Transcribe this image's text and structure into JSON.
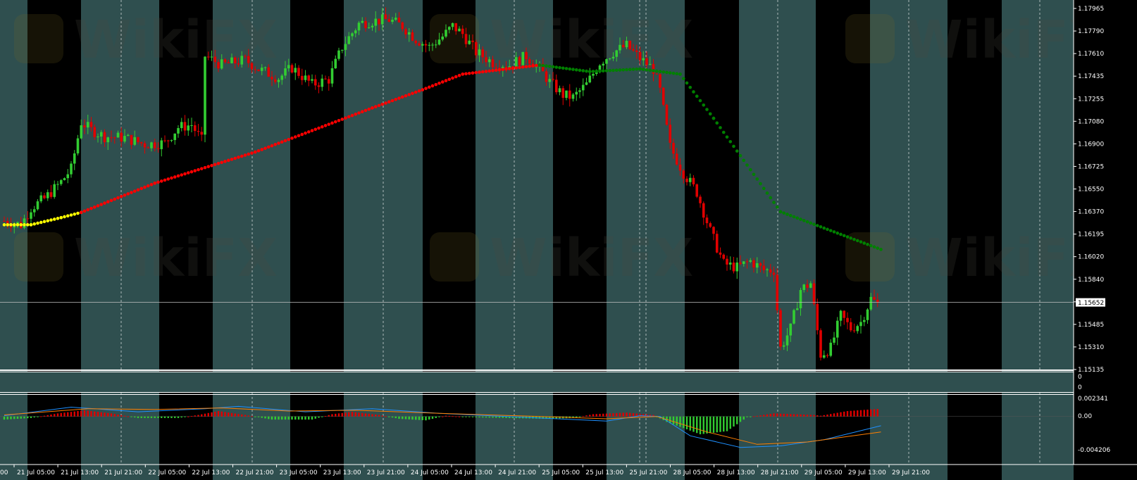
{
  "colors": {
    "bg_dark": "#000000",
    "bg_band": "#2f4f4f",
    "bull_candle": "#32cd32",
    "bear_candle": "#e00000",
    "trail_yellow": "#ffff00",
    "trail_red": "#ff0000",
    "trail_green": "#008000",
    "macd_pos": "#e00000",
    "macd_neg": "#32cd32",
    "macd_line": "#1e90ff",
    "signal_line": "#ff7f00",
    "grid_dash": "#ffffff",
    "text": "#ffffff"
  },
  "watermark": "WikiFX",
  "chart_data": [
    {
      "type": "candlestick",
      "title": "",
      "ylim": [
        1.15135,
        1.17965
      ],
      "yticks": [
        "1.17965",
        "1.17790",
        "1.17610",
        "1.17435",
        "1.17255",
        "1.17080",
        "1.16900",
        "1.16725",
        "1.16550",
        "1.16370",
        "1.16195",
        "1.16020",
        "1.15840",
        "1.15665",
        "1.15485",
        "1.15310",
        "1.15135"
      ],
      "current_price": "1.15652",
      "x_labels": [
        "21 Jul 05:00",
        "21 Jul 13:00",
        "21 Jul 21:00",
        "22 Jul 05:00",
        "22 Jul 13:00",
        "22 Jul 21:00",
        "23 Jul 05:00",
        "23 Jul 13:00",
        "23 Jul 21:00",
        "24 Jul 05:00",
        "24 Jul 13:00",
        "24 Jul 21:00",
        "25 Jul 05:00",
        "25 Jul 13:00",
        "25 Jul 21:00",
        "28 Jul 05:00",
        "28 Jul 13:00",
        "28 Jul 21:00",
        "29 Jul 05:00",
        "29 Jul 13:00",
        "29 Jul 21:00"
      ],
      "first_label_partial": "00",
      "trail": {
        "segments": [
          {
            "color": "yellow",
            "points": [
              [
                0,
                1.1625
              ],
              [
                8,
                1.1625
              ],
              [
                17,
                1.16305
              ],
              [
                23,
                1.16345
              ]
            ]
          },
          {
            "color": "red",
            "points": [
              [
                23,
                1.16345
              ],
              [
                45,
                1.1657
              ],
              [
                75,
                1.1681
              ],
              [
                110,
                1.1715
              ],
              [
                125,
                1.1729
              ],
              [
                137,
                1.1741
              ],
              [
                160,
                1.1748
              ]
            ]
          },
          {
            "color": "green",
            "points": [
              [
                160,
                1.1748
              ],
              [
                175,
                1.1743
              ],
              [
                190,
                1.1745
              ],
              [
                202,
                1.1741
              ],
              [
                212,
                1.1707
              ],
              [
                232,
                1.1635
              ],
              [
                262,
                1.1606
              ]
            ]
          }
        ]
      },
      "candles_ohlc_from": 1.1628,
      "candles_path": [
        [
          0,
          1.1628
        ],
        [
          5,
          1.1625
        ],
        [
          8,
          1.1638
        ],
        [
          12,
          1.1645
        ],
        [
          17,
          1.1658
        ],
        [
          20,
          1.1668
        ],
        [
          23,
          1.1704
        ],
        [
          26,
          1.1698
        ],
        [
          30,
          1.1693
        ],
        [
          36,
          1.1692
        ],
        [
          42,
          1.1687
        ],
        [
          48,
          1.1688
        ],
        [
          52,
          1.17
        ],
        [
          56,
          1.1702
        ],
        [
          59,
          1.169
        ],
        [
          60,
          1.1755
        ],
        [
          65,
          1.1748
        ],
        [
          72,
          1.1752
        ],
        [
          76,
          1.1745
        ],
        [
          82,
          1.1738
        ],
        [
          86,
          1.1746
        ],
        [
          92,
          1.1733
        ],
        [
          97,
          1.1737
        ],
        [
          101,
          1.1762
        ],
        [
          106,
          1.178
        ],
        [
          110,
          1.1782
        ],
        [
          115,
          1.1783
        ],
        [
          119,
          1.1778
        ],
        [
          123,
          1.1768
        ],
        [
          127,
          1.1762
        ],
        [
          131,
          1.177
        ],
        [
          134,
          1.1778
        ],
        [
          137,
          1.1772
        ],
        [
          141,
          1.1758
        ],
        [
          146,
          1.175
        ],
        [
          151,
          1.1748
        ],
        [
          156,
          1.1755
        ],
        [
          160,
          1.1745
        ],
        [
          163,
          1.1735
        ],
        [
          167,
          1.1725
        ],
        [
          170,
          1.1723
        ],
        [
          174,
          1.1733
        ],
        [
          178,
          1.175
        ],
        [
          182,
          1.1758
        ],
        [
          186,
          1.1763
        ],
        [
          190,
          1.1753
        ],
        [
          194,
          1.1745
        ],
        [
          196,
          1.1728
        ],
        [
          199,
          1.1685
        ],
        [
          203,
          1.1665
        ],
        [
          207,
          1.165
        ],
        [
          211,
          1.162
        ],
        [
          215,
          1.1595
        ],
        [
          219,
          1.1592
        ],
        [
          223,
          1.1597
        ],
        [
          227,
          1.159
        ],
        [
          230,
          1.159
        ],
        [
          232,
          1.153
        ],
        [
          235,
          1.1545
        ],
        [
          238,
          1.1575
        ],
        [
          241,
          1.158
        ],
        [
          244,
          1.1525
        ],
        [
          247,
          1.153
        ],
        [
          250,
          1.1555
        ],
        [
          253,
          1.1545
        ],
        [
          256,
          1.155
        ],
        [
          259,
          1.1568
        ],
        [
          262,
          1.1562
        ]
      ]
    },
    {
      "type": "line",
      "title": "",
      "yticks": [
        "0",
        "0"
      ]
    },
    {
      "type": "bar",
      "title": "",
      "ylim": [
        -0.004206,
        0.002341
      ],
      "yticks": [
        "0.002341",
        "0.00",
        "-0.004206"
      ],
      "histogram_path": [
        [
          0,
          -0.0004
        ],
        [
          8,
          -0.0002
        ],
        [
          16,
          0.0004
        ],
        [
          24,
          0.0008
        ],
        [
          32,
          0.0004
        ],
        [
          40,
          -0.0002
        ],
        [
          52,
          -0.0002
        ],
        [
          58,
          0.0002
        ],
        [
          64,
          0.0007
        ],
        [
          72,
          0.0002
        ],
        [
          80,
          -0.0004
        ],
        [
          92,
          -0.0004
        ],
        [
          98,
          0.0003
        ],
        [
          104,
          0.0006
        ],
        [
          112,
          0.0002
        ],
        [
          118,
          -0.0003
        ],
        [
          126,
          -0.0005
        ],
        [
          132,
          0.0001
        ],
        [
          140,
          -0.0001
        ],
        [
          150,
          -0.0002
        ],
        [
          162,
          -0.0003
        ],
        [
          170,
          -0.0002
        ],
        [
          176,
          0.0003
        ],
        [
          186,
          0.0005
        ],
        [
          194,
          0.0002
        ],
        [
          198,
          -0.0007
        ],
        [
          208,
          -0.0023
        ],
        [
          216,
          -0.0019
        ],
        [
          222,
          -0.0001
        ],
        [
          230,
          0.0004
        ],
        [
          242,
          0.0002
        ],
        [
          244,
          0.0001
        ],
        [
          252,
          0.0007
        ],
        [
          262,
          0.001
        ]
      ],
      "macd_path": [
        [
          0,
          0.0001
        ],
        [
          20,
          0.0012
        ],
        [
          40,
          0.0006
        ],
        [
          60,
          0.001
        ],
        [
          70,
          0.0013
        ],
        [
          90,
          0.0006
        ],
        [
          110,
          0.001
        ],
        [
          130,
          0.0004
        ],
        [
          160,
          -0.0002
        ],
        [
          180,
          -0.0006
        ],
        [
          190,
          0.0001
        ],
        [
          196,
          0.0
        ],
        [
          205,
          -0.0025
        ],
        [
          220,
          -0.004
        ],
        [
          232,
          -0.0038
        ],
        [
          245,
          -0.003
        ],
        [
          262,
          -0.0012
        ]
      ],
      "signal_path": [
        [
          0,
          0.0002
        ],
        [
          25,
          0.001
        ],
        [
          45,
          0.0009
        ],
        [
          65,
          0.0011
        ],
        [
          85,
          0.0007
        ],
        [
          105,
          0.0008
        ],
        [
          130,
          0.0004
        ],
        [
          160,
          0.0
        ],
        [
          180,
          -0.0003
        ],
        [
          195,
          0.0
        ],
        [
          210,
          -0.002
        ],
        [
          225,
          -0.0036
        ],
        [
          240,
          -0.0033
        ],
        [
          262,
          -0.002
        ]
      ]
    }
  ]
}
